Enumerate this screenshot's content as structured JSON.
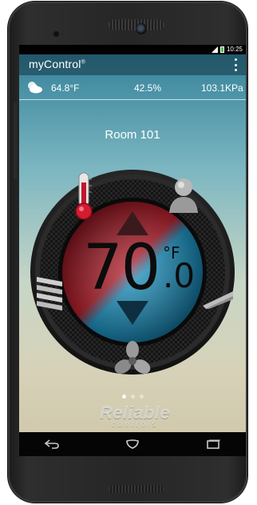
{
  "status_bar": {
    "time": "10:25",
    "icons": [
      "signal-icon",
      "battery-icon"
    ]
  },
  "app_bar": {
    "title": "myControl",
    "title_mark": "®",
    "menu_icon": "overflow-menu-icon"
  },
  "weather": {
    "icon": "partly-cloudy-icon",
    "temperature": "64.8°F",
    "humidity": "42.5%",
    "pressure": "103.1KPa"
  },
  "room": {
    "name": "Room 101"
  },
  "thermostat": {
    "setpoint_whole": "70",
    "setpoint_decimal": ".0",
    "unit": "°F",
    "icons": [
      "thermometer-icon",
      "occupancy-person-icon",
      "heat-vents-icon",
      "dampers-icon",
      "fan-icon",
      "increase-arrow-icon",
      "decrease-arrow-icon"
    ],
    "colors": {
      "heat": "#b31d2a",
      "cool": "#1ba6d8"
    }
  },
  "pager": {
    "count": 3,
    "active_index": 0
  },
  "brand": {
    "name": "Reliable",
    "tagline": "controls"
  },
  "nav_bar": {
    "icons": [
      "back-icon",
      "home-icon",
      "recent-apps-icon"
    ]
  }
}
